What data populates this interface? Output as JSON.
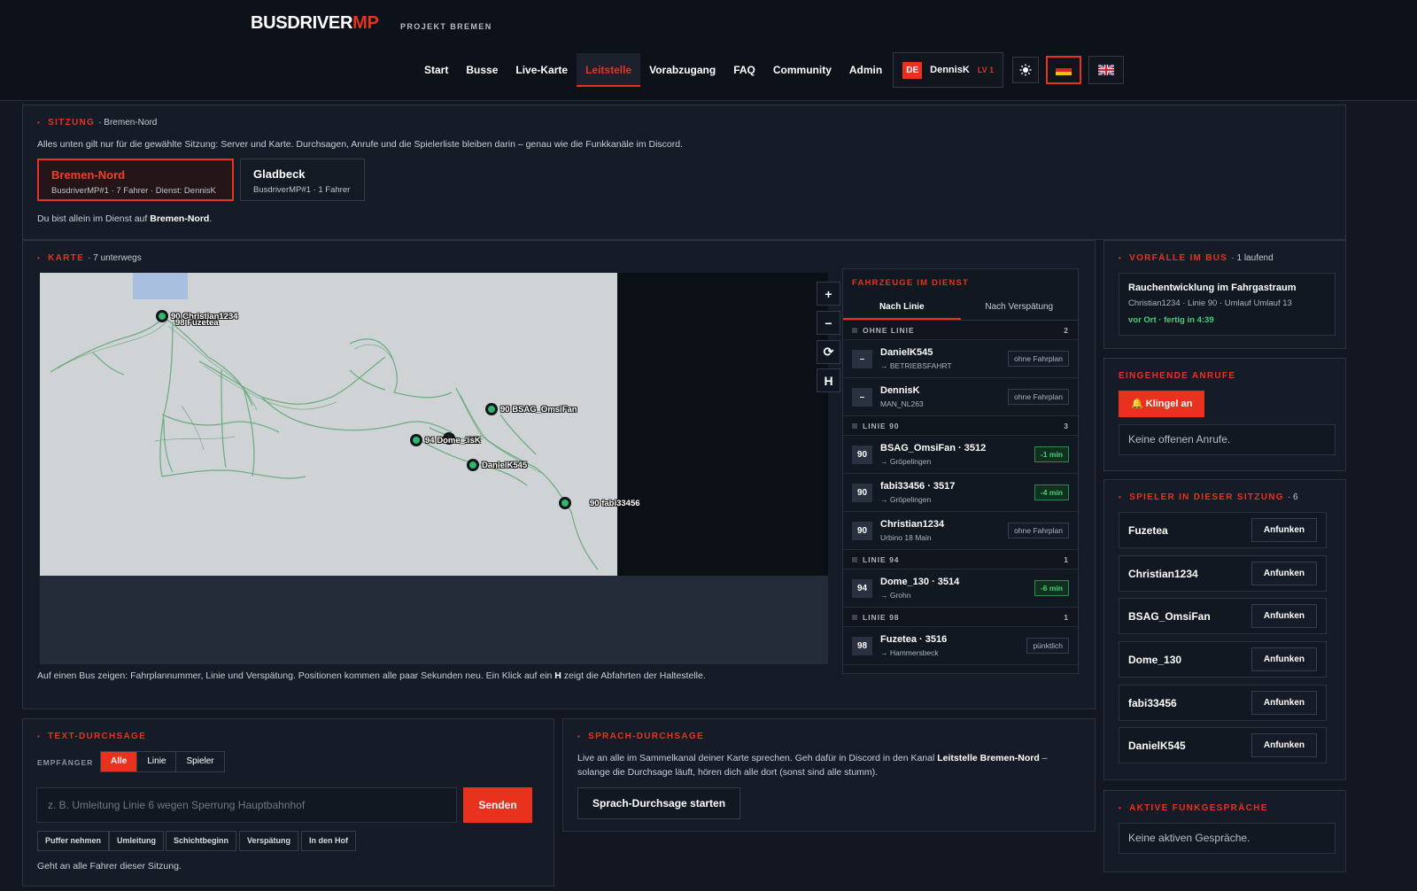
{
  "header": {
    "brand_main": "BUSDRIVER",
    "brand_accent": "MP",
    "brand_sub": "PROJEKT BREMEN",
    "nav": [
      "Start",
      "Busse",
      "Live-Karte",
      "Leitstelle",
      "Vorabzugang",
      "FAQ",
      "Community",
      "Admin"
    ],
    "active_nav": "Leitstelle",
    "user": {
      "lang_badge": "DE",
      "name": "DennisK",
      "level": "LV 1"
    },
    "theme_icon": "sun-icon",
    "flags": [
      "flag-de-icon",
      "flag-uk-icon"
    ]
  },
  "session": {
    "title": "SITZUNG",
    "subtitle": "· Bremen-Nord",
    "description": "Alles unten gilt nur für die gewählte Sitzung: Server und Karte. Durchsagen, Anrufe und die Spielerliste bleiben darin – genau wie die Funkkanäle im Discord.",
    "cards": [
      {
        "name": "Bremen-Nord",
        "meta": "BusdriverMP#1 · 7 Fahrer · Dienst: DennisK"
      },
      {
        "name": "Gladbeck",
        "meta": "BusdriverMP#1 · 1 Fahrer"
      }
    ],
    "alone_text": "Du bist allein im Dienst auf ",
    "alone_place": "Bremen-Nord",
    "alone_end": "."
  },
  "map": {
    "title": "KARTE",
    "subtitle": "· 7 unterwegs",
    "controls": [
      "+",
      "−",
      "⟳",
      "H"
    ],
    "markers": [
      {
        "label": "90 Christian1234"
      },
      {
        "label": "98 Fuzetea"
      },
      {
        "label": "90 BSAG_OmsiFan"
      },
      {
        "label": "94 Dome_130"
      },
      {
        "label": "isK"
      },
      {
        "label": "DanielK545"
      },
      {
        "label": "90 fabi33456"
      }
    ],
    "footer_pre": "Auf einen Bus zeigen: Fahrplannummer, Linie und Verspätung. Positionen kommen alle paar Sekunden neu. Ein Klick auf ein ",
    "footer_key": "H",
    "footer_post": " zeigt die Abfahrten der Haltestelle."
  },
  "vehicles": {
    "title": "FAHRZEUGE IM DIENST",
    "tabs": [
      "Nach Linie",
      "Nach Verspätung"
    ],
    "groups": [
      {
        "name": "OHNE LINIE",
        "count": "2",
        "rows": [
          {
            "badge": "–",
            "name": "DanielK545",
            "sub": "→ BETRIEBSFAHRT",
            "tag": "ohne Fahrplan",
            "green": false
          },
          {
            "badge": "–",
            "name": "DennisK",
            "sub": "MAN_NL263",
            "tag": "ohne Fahrplan",
            "green": false
          }
        ]
      },
      {
        "name": "LINIE 90",
        "count": "3",
        "rows": [
          {
            "badge": "90",
            "name": "BSAG_OmsiFan · 3512",
            "sub": "→ Gröpelingen",
            "tag": "-1 min",
            "green": true
          },
          {
            "badge": "90",
            "name": "fabi33456 · 3517",
            "sub": "→ Gröpelingen",
            "tag": "-4 min",
            "green": true
          },
          {
            "badge": "90",
            "name": "Christian1234",
            "sub": "Urbino 18 Main",
            "tag": "ohne Fahrplan",
            "green": false
          }
        ]
      },
      {
        "name": "LINIE 94",
        "count": "1",
        "rows": [
          {
            "badge": "94",
            "name": "Dome_130 · 3514",
            "sub": "→ Grohn",
            "tag": "-6 min",
            "green": true
          }
        ]
      },
      {
        "name": "LINIE 98",
        "count": "1",
        "rows": [
          {
            "badge": "98",
            "name": "Fuzetea · 3516",
            "sub": "→ Hammersbeck",
            "tag": "pünktlich",
            "green": false
          }
        ]
      }
    ]
  },
  "incidents": {
    "title": "VORFÄLLE IM BUS",
    "subtitle": "· 1 laufend",
    "item": {
      "title": "Rauchentwicklung im Fahrgastraum",
      "meta": "Christian1234 · Linie 90 · Umlauf Umlauf 13",
      "status": "vor Ort · fertig in 4:39"
    }
  },
  "calls": {
    "title": "EINGEHENDE ANRUFE",
    "ring_button": "🔔 Klingel an",
    "empty": "Keine offenen Anrufe."
  },
  "players": {
    "title": "SPIELER IN DIESER SITZUNG",
    "subtitle": "· 6",
    "call_label": "Anfunken",
    "list": [
      "Fuzetea",
      "Christian1234",
      "BSAG_OmsiFan",
      "Dome_130",
      "fabi33456",
      "DanielK545"
    ]
  },
  "radio": {
    "title": "AKTIVE FUNKGESPRÄCHE",
    "empty": "Keine aktiven Gespräche."
  },
  "text_announce": {
    "title": "TEXT-DURCHSAGE",
    "recipient_label": "EMPFÄNGER",
    "segments": [
      "Alle",
      "Linie",
      "Spieler"
    ],
    "placeholder": "z. B. Umleitung Linie 6 wegen Sperrung Hauptbahnhof",
    "send": "Senden",
    "chips": [
      "Puffer nehmen",
      "Umleitung",
      "Schichtbeginn",
      "Verspätung",
      "In den Hof"
    ],
    "note": "Geht an alle Fahrer dieser Sitzung."
  },
  "voice_announce": {
    "title": "SPRACH-DURCHSAGE",
    "text_pre": "Live an alle im Sammelkanal deiner Karte sprechen. Geh dafür in Discord in den Kanal ",
    "channel": "Leitstelle Bremen-Nord",
    "text_post": " – solange die Durchsage läuft, hören dich alle dort (sonst sind alle stumm).",
    "button": "Sprach-Durchsage starten"
  }
}
